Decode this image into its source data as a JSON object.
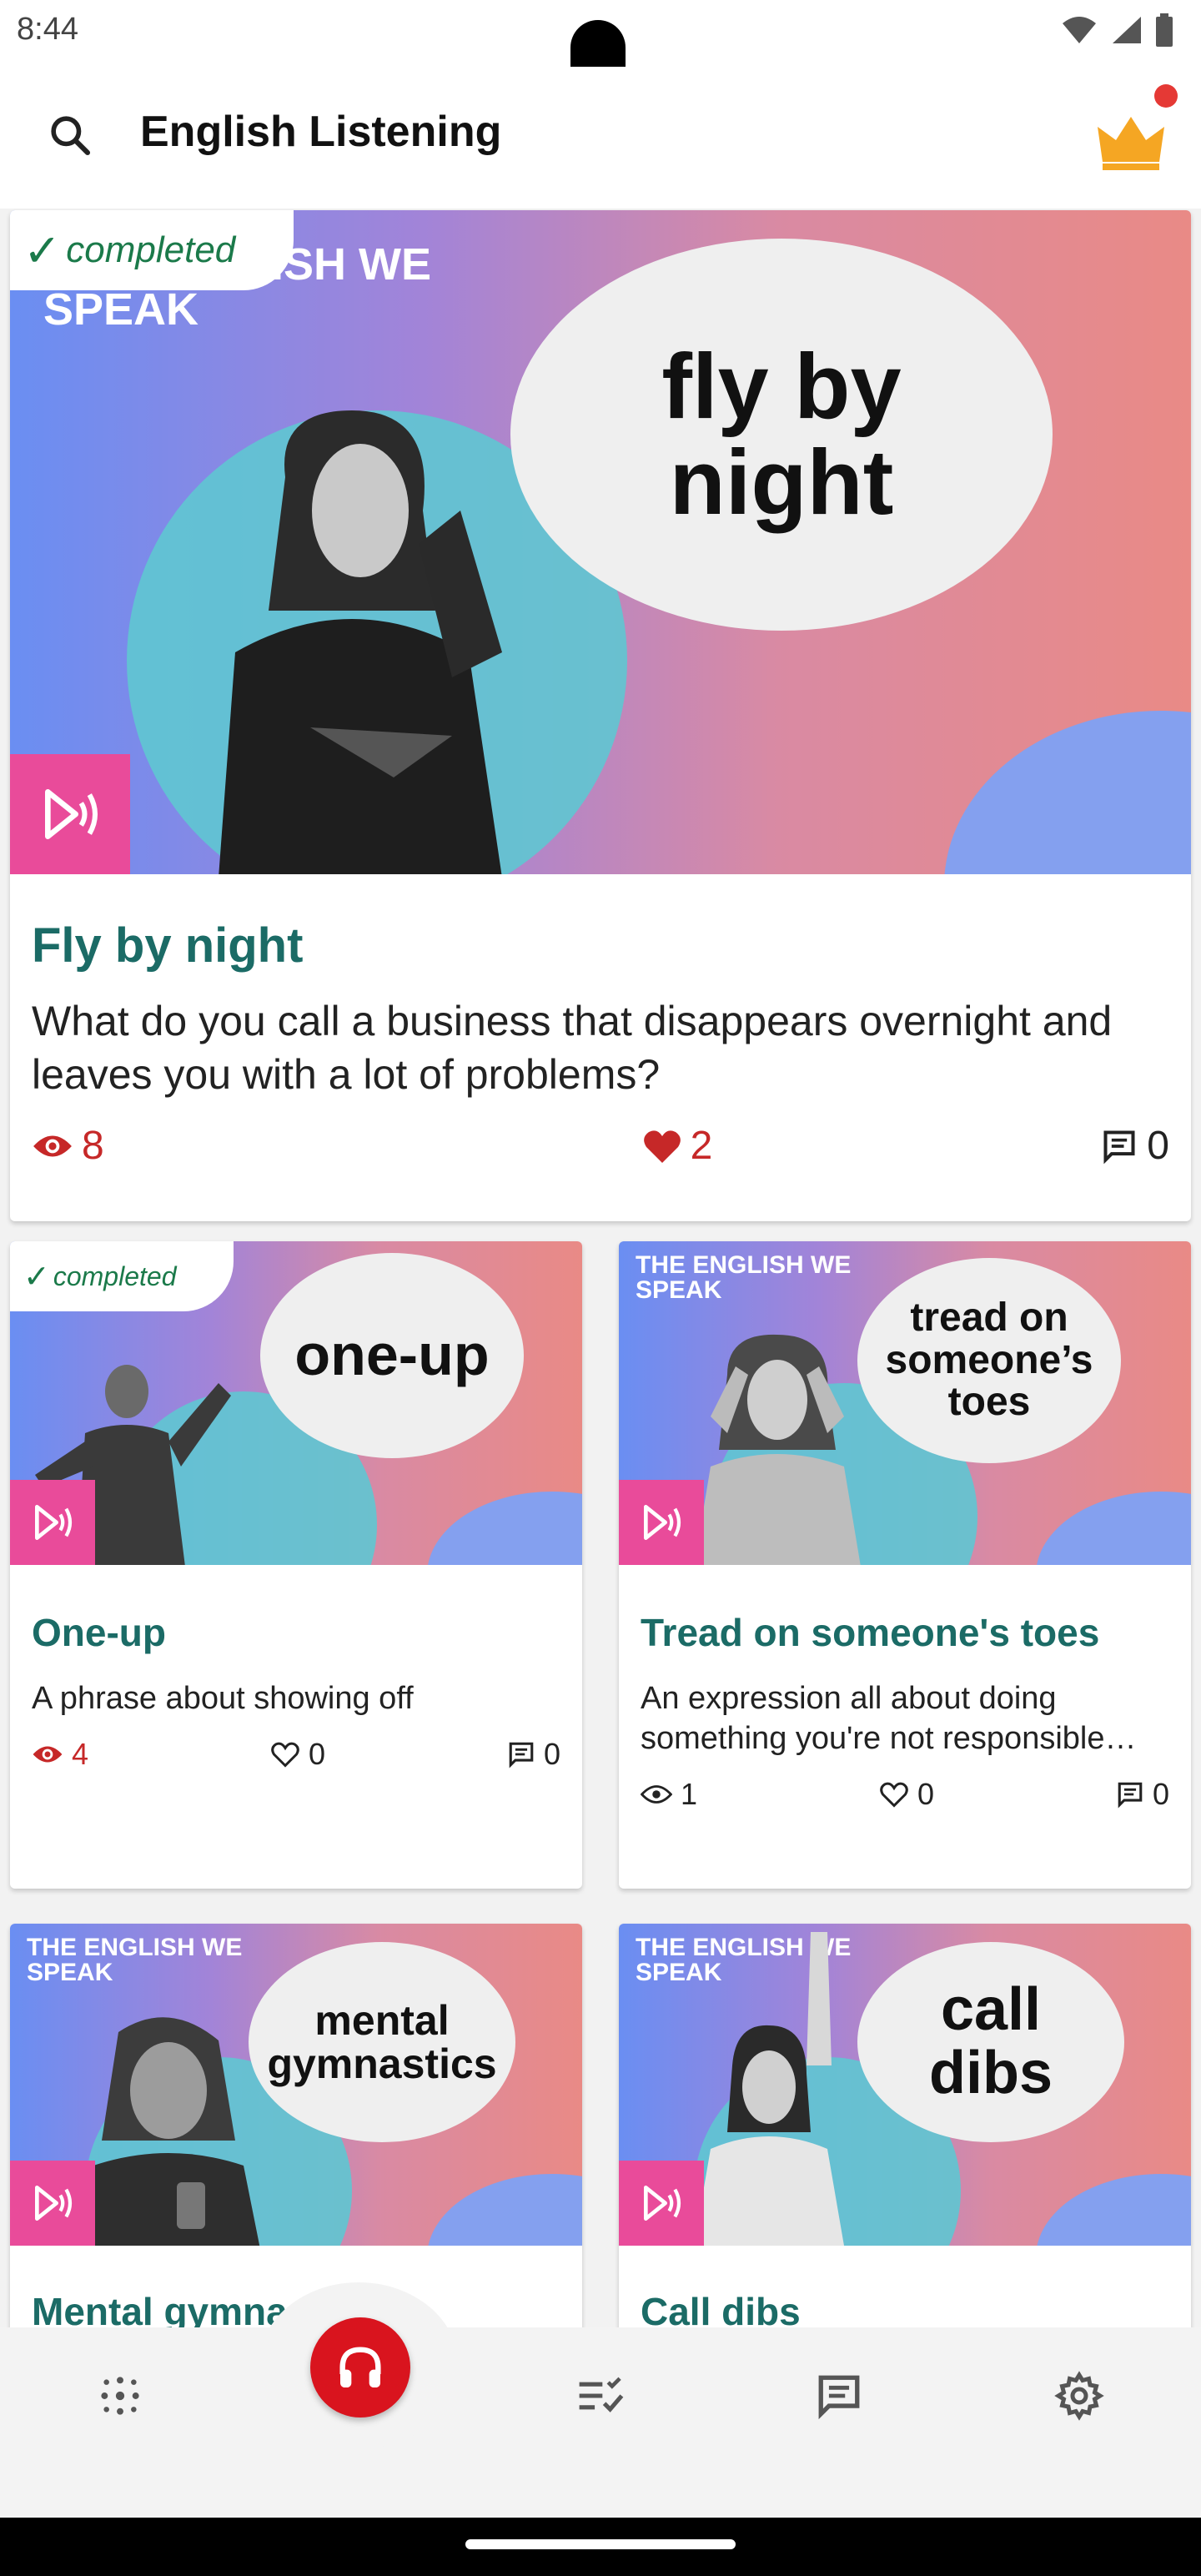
{
  "status": {
    "time": "8:44"
  },
  "header": {
    "title": "English Listening"
  },
  "featured": {
    "completed": "completed",
    "series": "THE ENGLISH WE SPEAK",
    "bubble": "fly by night",
    "title": "Fly by night",
    "description": "What do you call a business that disappears overnight and leaves you with a lot of problems?",
    "views": "8",
    "likes": "2",
    "comments": "0"
  },
  "cards": [
    {
      "completed": "completed",
      "series": "",
      "bubble": "one-up",
      "title": "One-up",
      "description": "A phrase about showing off",
      "views": "4",
      "likes": "0",
      "comments": "0"
    },
    {
      "series": "THE ENGLISH WE SPEAK",
      "bubble": "tread on someone’s toes",
      "title": "Tread on someone's toes",
      "description": "An expression all about doing something you're not responsible…",
      "views": "1",
      "likes": "0",
      "comments": "0"
    },
    {
      "series": "THE ENGLISH WE SPEAK",
      "bubble": "mental gymnastics",
      "title": "Mental gymnastics"
    },
    {
      "series": "THE ENGLISH WE SPEAK",
      "bubble": "call dibs",
      "title": "Call dibs"
    }
  ],
  "colors": {
    "accent": "#1b6b66",
    "red": "#c62828",
    "fab": "#d9141e",
    "badge": "#e94b9a"
  }
}
